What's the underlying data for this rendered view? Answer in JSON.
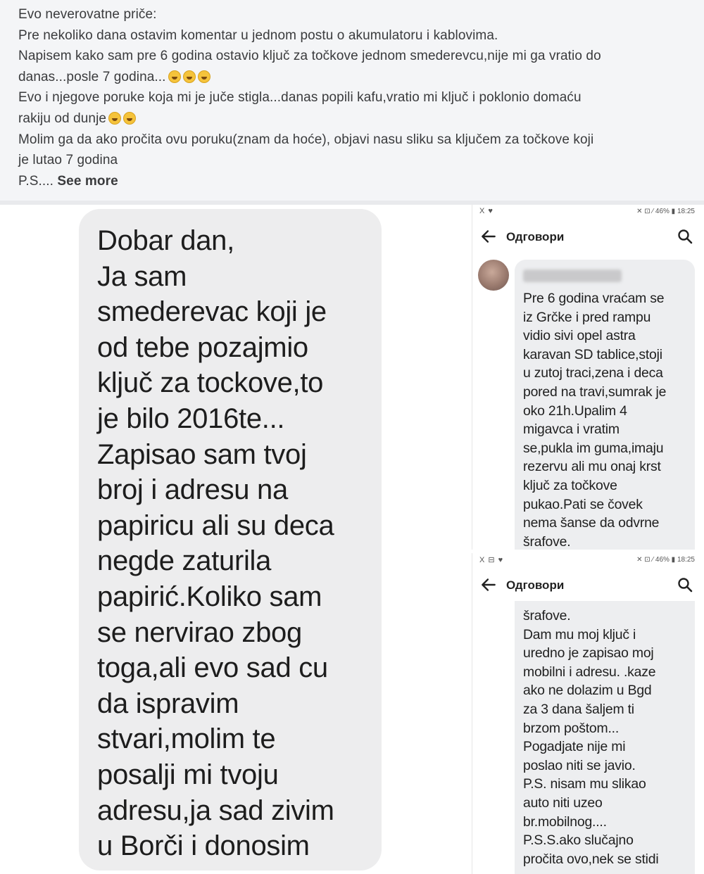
{
  "post": {
    "lines": [
      "Evo neverovatne priče:",
      "Pre nekoliko dana ostavim komentar u jednom postu o akumulatoru i kablovima.",
      "Napisem kako sam pre 6 godina ostavio ključ za točkove jednom smederevcu,nije mi ga vratio do",
      "danas...posle 7 godina...",
      "Evo i njegove poruke koja mi je juče stigla...danas popili kafu,vratio mi ključ i poklonio domaću",
      "rakiju od dunje",
      "Molim ga da ako pročita ovu poruku(znam da hoće), objavi nasu sliku sa ključem za točkove koji",
      "je lutao 7 godina",
      "P.S...."
    ],
    "see_more": "See more",
    "emoji_icon": "laughing-emoji"
  },
  "message": {
    "text_lines": [
      "Dobar dan,",
      "Ja sam",
      "smederevac koji je",
      "od tebe pozajmio",
      "ključ za tockove,to",
      "je bilo 2016te...",
      "Zapisao sam tvoj",
      "broj i adresu na",
      "papiricu ali su deca",
      "negde zaturila",
      "papirić.Koliko sam",
      "se nervirao zbog",
      "toga,ali evo sad cu",
      "da ispravim",
      "stvari,molim te",
      "posalji mi tvoju",
      "adresu,ja sad zivim",
      "u Borči i donosim"
    ]
  },
  "phone1": {
    "status_left": "X ♥",
    "status_right": "✕ ⊡ ⁄ 46% ▮ 18:25",
    "title": "Одговори",
    "reply_lines": [
      "Pre 6 godina vraćam se",
      "iz Grčke i pred rampu",
      "vidio sivi opel astra",
      "karavan SD tablice,stoji",
      "u zutoj traci,zena i deca",
      "pored na travi,sumrak je",
      "oko 21h.Upalim 4",
      "migavca i vratim",
      "se,pukla im guma,imaju",
      "rezervu ali mu onaj krst",
      "ključ za točkove",
      "pukao.Pati se čovek",
      "nema šanse da odvrne",
      "šrafove."
    ]
  },
  "phone2": {
    "status_left": "X ⊟ ♥",
    "status_right": "✕ ⊡ ⁄ 46% ▮ 18:25",
    "title": "Одговори",
    "reply_lines": [
      "šrafove.",
      "Dam mu moj ključ i",
      "uredno je zapisao moj",
      "mobilni i adresu. .kaze",
      "ako ne dolazim u Bgd",
      "za 3 dana šaljem ti",
      "brzom poštom...",
      "Pogadjate nije mi",
      "poslao niti se javio.",
      "P.S. nisam mu slikao",
      "auto niti uzeo",
      "br.mobilnog....",
      "P.S.S.ako slučajno",
      "pročita ovo,nek se stidi"
    ]
  },
  "colors": {
    "post_bg": "#f4f5f7",
    "bubble_bg": "#ededee",
    "reply_bg": "#edeef0"
  }
}
